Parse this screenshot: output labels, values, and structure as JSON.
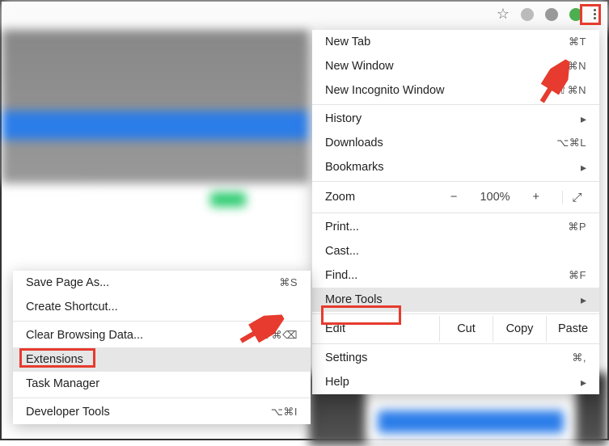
{
  "toolbar": {
    "star": "☆",
    "kebab_name": "menu-icon"
  },
  "main_menu": {
    "groups": [
      [
        {
          "label": "New Tab",
          "shortcut": "⌘T",
          "name": "menu-new-tab"
        },
        {
          "label": "New Window",
          "shortcut": "⌘N",
          "name": "menu-new-window"
        },
        {
          "label": "New Incognito Window",
          "shortcut": "⇧⌘N",
          "name": "menu-incognito"
        }
      ],
      [
        {
          "label": "History",
          "sub": "▸",
          "name": "menu-history"
        },
        {
          "label": "Downloads",
          "shortcut": "⌥⌘L",
          "name": "menu-downloads"
        },
        {
          "label": "Bookmarks",
          "sub": "▸",
          "name": "menu-bookmarks"
        }
      ]
    ],
    "zoom": {
      "label": "Zoom",
      "minus": "−",
      "value": "100%",
      "plus": "+",
      "fullscreen": "⤢"
    },
    "groups2": [
      [
        {
          "label": "Print...",
          "shortcut": "⌘P",
          "name": "menu-print"
        },
        {
          "label": "Cast...",
          "name": "menu-cast"
        },
        {
          "label": "Find...",
          "shortcut": "⌘F",
          "name": "menu-find"
        },
        {
          "label": "More Tools",
          "sub": "▸",
          "name": "menu-more-tools",
          "highlight": true
        }
      ]
    ],
    "edit": {
      "label": "Edit",
      "cut": "Cut",
      "copy": "Copy",
      "paste": "Paste"
    },
    "groups3": [
      [
        {
          "label": "Settings",
          "shortcut": "⌘,",
          "name": "menu-settings"
        },
        {
          "label": "Help",
          "sub": "▸",
          "name": "menu-help"
        }
      ]
    ]
  },
  "sub_menu": {
    "items": [
      {
        "label": "Save Page As...",
        "shortcut": "⌘S",
        "name": "sub-save-page"
      },
      {
        "label": "Create Shortcut...",
        "name": "sub-create-shortcut"
      },
      {
        "type": "sep"
      },
      {
        "label": "Clear Browsing Data...",
        "shortcut": "⇧⌘⌫",
        "name": "sub-clear-data"
      },
      {
        "label": "Extensions",
        "name": "sub-extensions",
        "highlight": true
      },
      {
        "label": "Task Manager",
        "name": "sub-task-manager"
      },
      {
        "type": "sep"
      },
      {
        "label": "Developer Tools",
        "shortcut": "⌥⌘I",
        "name": "sub-dev-tools"
      }
    ]
  },
  "colors": {
    "red": "#e63b2e"
  }
}
